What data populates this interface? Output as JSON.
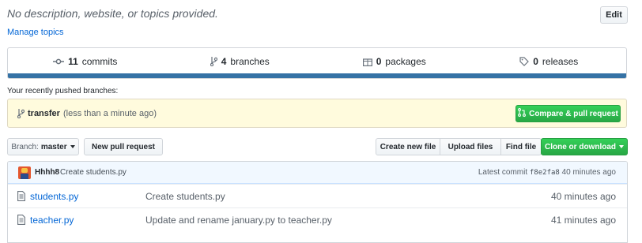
{
  "repo": {
    "description": "No description, website, or topics provided.",
    "edit_label": "Edit",
    "manage_topics": "Manage topics"
  },
  "summary": {
    "commits_count": "11",
    "commits_label": "commits",
    "branches_count": "4",
    "branches_label": "branches",
    "packages_count": "0",
    "packages_label": "packages",
    "releases_count": "0",
    "releases_label": "releases",
    "language_bar_color": "#3572a5"
  },
  "recent": {
    "label": "Your recently pushed branches:",
    "branch": "transfer",
    "time": "(less than a minute ago)",
    "compare_label": "Compare & pull request"
  },
  "toolbar": {
    "branch_prefix": "Branch:",
    "branch_name": "master",
    "new_pr": "New pull request",
    "create_file": "Create new file",
    "upload_files": "Upload files",
    "find_file": "Find file",
    "clone": "Clone or download"
  },
  "commit": {
    "author": "Hhhh8",
    "message": "Create students.py",
    "latest_prefix": "Latest commit",
    "sha": "f8e2fa8",
    "age": "40 minutes ago"
  },
  "files": [
    {
      "name": "students.py",
      "message": "Create students.py",
      "age": "40 minutes ago"
    },
    {
      "name": "teacher.py",
      "message": "Update and rename january.py to teacher.py",
      "age": "41 minutes ago"
    }
  ]
}
